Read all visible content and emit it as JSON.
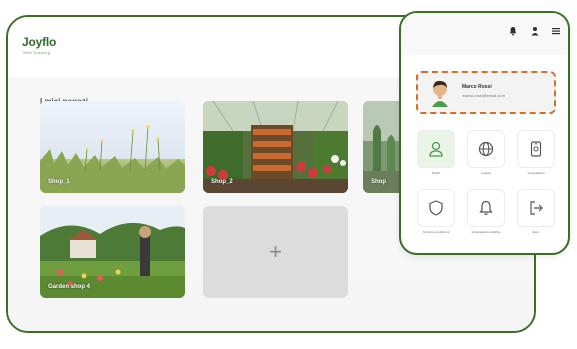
{
  "app": {
    "logo": "Joyflo",
    "logo_subtitle": "Web Drawing"
  },
  "main": {
    "section_title": "I miei negozi",
    "shops": [
      {
        "label": "Shop_1"
      },
      {
        "label": "Shop_2"
      },
      {
        "label": "Shop"
      },
      {
        "label": "Garden shop 4"
      }
    ],
    "add_shop_symbol": "+"
  },
  "popup": {
    "top_icons": [
      "bell-icon",
      "user-icon",
      "menu-icon"
    ],
    "user": {
      "name": "Marco Rossi",
      "email": "marco.rossi@email.com"
    },
    "tiles": [
      {
        "label": "Profilo",
        "icon": "user-icon",
        "active": true
      },
      {
        "label": "Lingua",
        "icon": "globe-icon",
        "active": false
      },
      {
        "label": "Impostazioni",
        "icon": "phone-settings-icon",
        "active": false
      },
      {
        "label": "Termini e condizioni",
        "icon": "shield-icon",
        "active": false
      },
      {
        "label": "Impostazioni notifiche",
        "icon": "bell-icon",
        "active": false
      },
      {
        "label": "Esci",
        "icon": "logout-icon",
        "active": false
      }
    ]
  },
  "colors": {
    "accent": "#3b6e25",
    "highlight_border": "#d4702a",
    "active_tile": "#e9f4e6"
  }
}
